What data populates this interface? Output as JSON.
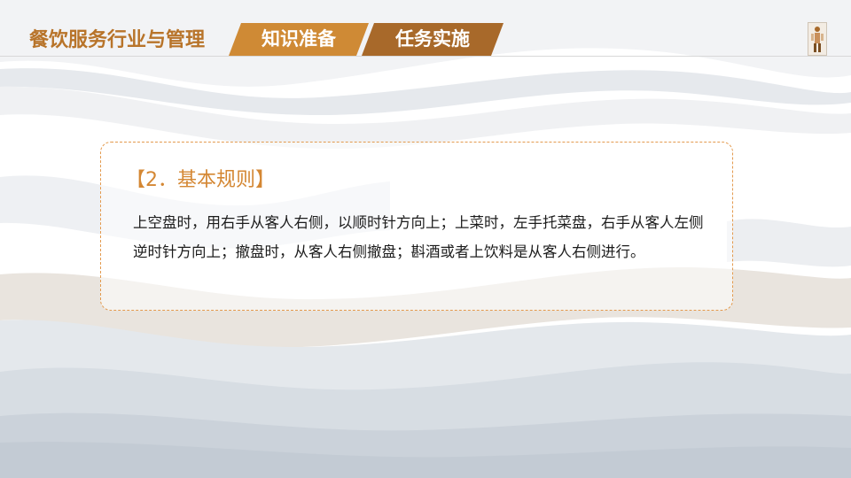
{
  "header": {
    "course_title": "餐饮服务行业与管理",
    "tabs": [
      {
        "label": "知识准备",
        "color": "#cf8a35"
      },
      {
        "label": "任务实施",
        "color": "#a8692a"
      }
    ]
  },
  "card": {
    "title": "【2．基本规则】",
    "body": "上空盘时，用右手从客人右侧，以顺时针方向上；上菜时，左手托菜盘，右手从客人左侧逆时针方向上；撤盘时，从客人右侧撤盘；斟酒或者上饮料是从客人右侧进行。"
  },
  "colors": {
    "accent": "#d48733",
    "title_brown": "#b8742a",
    "wave_light": "#e8ebef",
    "wave_mid": "#d5dbe1",
    "wave_warm": "#e7e2dc"
  }
}
